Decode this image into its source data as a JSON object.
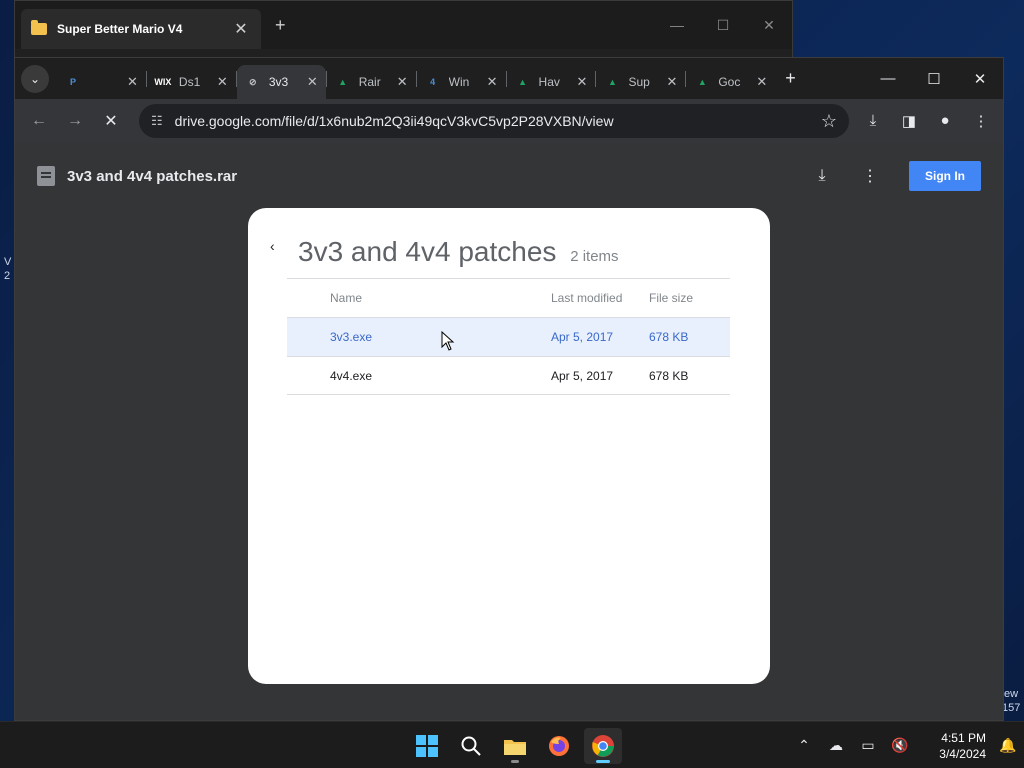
{
  "desktop": {
    "fragments": [
      "V",
      "2",
      "ew",
      "157"
    ]
  },
  "explorer": {
    "title": "Super Better Mario V4",
    "close": "✕",
    "new_tab": "+",
    "controls": [
      "—",
      "☐",
      "✕"
    ]
  },
  "browser": {
    "tabs": [
      {
        "label": "",
        "favicon": "P",
        "favicon_color": "#4a90d9",
        "active": false
      },
      {
        "label": "Ds1",
        "favicon": "WIX",
        "favicon_color": "#ffffff",
        "active": false
      },
      {
        "label": "3v3",
        "favicon": "⊘",
        "favicon_color": "#bdc1c6",
        "active": true
      },
      {
        "label": "Rair",
        "favicon": "▲",
        "favicon_color": "#1fa463",
        "active": false
      },
      {
        "label": "Win",
        "favicon": "4",
        "favicon_color": "#4a90d9",
        "active": false
      },
      {
        "label": "Hav",
        "favicon": "▲",
        "favicon_color": "#1fa463",
        "active": false
      },
      {
        "label": "Sup",
        "favicon": "▲",
        "favicon_color": "#1fa463",
        "active": false
      },
      {
        "label": "Goc",
        "favicon": "▲",
        "favicon_color": "#1fa463",
        "active": false
      }
    ],
    "tab_close": "✕",
    "new_tab": "+",
    "window_controls": [
      "—",
      "☐",
      "✕"
    ],
    "url": "drive.google.com/file/d/1x6nub2m2Q3ii49qcV3kvC5vp2P28VXBN/view"
  },
  "viewer": {
    "file_title": "3v3 and 4v4 patches.rar",
    "sign_in": "Sign In",
    "card": {
      "back": "‹",
      "title": "3v3 and 4v4 patches",
      "count": "2 items",
      "columns": {
        "name": "Name",
        "modified": "Last modified",
        "size": "File size"
      },
      "rows": [
        {
          "name": "3v3.exe",
          "modified": "Apr 5, 2017",
          "size": "678 KB",
          "selected": true
        },
        {
          "name": "4v4.exe",
          "modified": "Apr 5, 2017",
          "size": "678 KB",
          "selected": false
        }
      ]
    }
  },
  "taskbar": {
    "time": "4:51 PM",
    "date": "3/4/2024"
  }
}
